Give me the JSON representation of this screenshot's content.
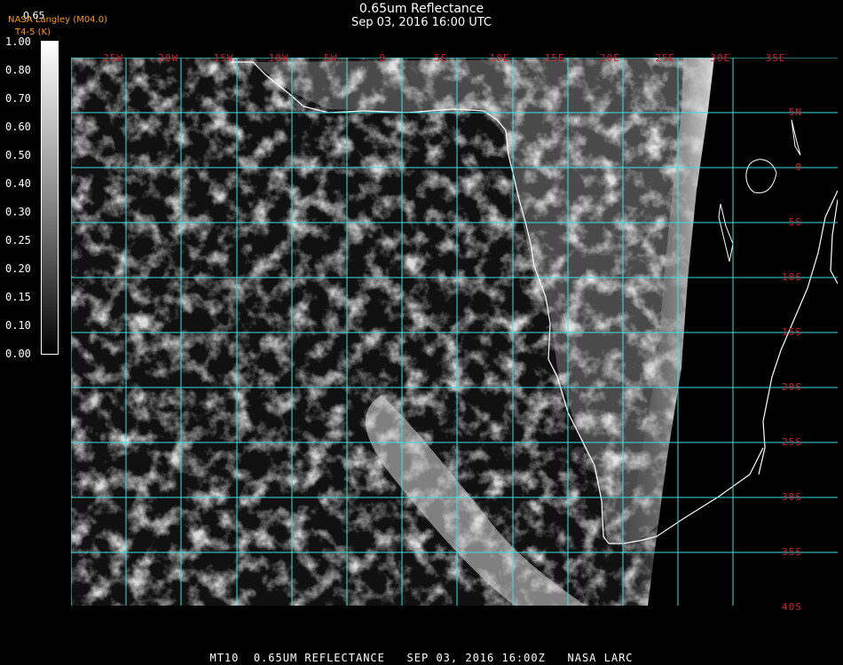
{
  "title": "0.65um Reflectance",
  "datetime": "Sep 03, 2016 16:00 UTC",
  "credit_1": "NASA Langley (M04.0)",
  "credit_2": "T4-5 (K)",
  "colorbar_title": "0.65",
  "colorbar_ticks": [
    "1.00",
    "0.80",
    "0.70",
    "0.60",
    "0.50",
    "0.40",
    "0.30",
    "0.25",
    "0.20",
    "0.15",
    "0.10",
    "0.00"
  ],
  "longitude_labels": [
    "25W",
    "20W",
    "15W",
    "10W",
    "5W",
    "0",
    "5E",
    "10E",
    "15E",
    "20E",
    "25E",
    "30E",
    "35E"
  ],
  "latitude_labels": [
    "5N",
    "0",
    "5S",
    "10S",
    "15S",
    "20S",
    "25S",
    "30S",
    "35S",
    "40S"
  ],
  "footer": "MT10  0.65UM REFLECTANCE   SEP 03, 2016 16:00Z   NASA LARC",
  "colors": {
    "grid": "#3de0e0",
    "labels": "#d0202a",
    "coast": "#ffffff",
    "credit": "#ff9a1a"
  }
}
